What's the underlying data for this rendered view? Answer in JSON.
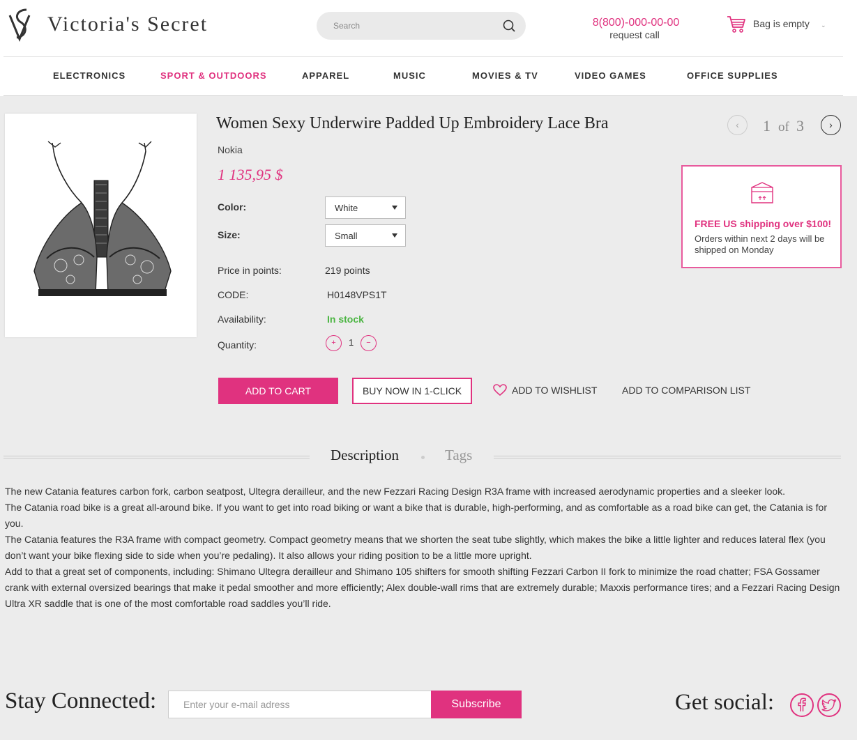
{
  "header": {
    "logo_text": "Victoria's Secret",
    "search_placeholder": "Search",
    "phone": "8(800)-000-00-00",
    "request_call": "request call",
    "bag_text": "Bag is empty"
  },
  "nav": {
    "items": [
      {
        "label": "ELECTRONICS",
        "active": false
      },
      {
        "label": "SPORT & OUTDOORS",
        "active": true
      },
      {
        "label": "APPAREL",
        "active": false
      },
      {
        "label": "MUSIC",
        "active": false
      },
      {
        "label": "MOVIES & TV",
        "active": false
      },
      {
        "label": "VIDEO GAMES",
        "active": false
      },
      {
        "label": "OFFICE SUPPLIES",
        "active": false
      }
    ]
  },
  "product": {
    "title": "Women Sexy Underwire Padded Up Embroidery Lace Bra",
    "brand": "Nokia",
    "price": "1 135,95 $",
    "color_label": "Color:",
    "color_value": "White",
    "size_label": "Size:",
    "size_value": "Small",
    "points_label": "Price in points:",
    "points_value": "219 points",
    "code_label": "CODE:",
    "code_value": "H0148VPS1T",
    "availability_label": "Availability:",
    "availability_value": "In stock",
    "quantity_label": "Quantity:",
    "quantity_value": "1",
    "qty_plus": "+",
    "qty_minus": "−",
    "add_to_cart": "ADD TO CART",
    "buy_now": "BUY NOW IN 1-CLICK",
    "add_to_wishlist": "ADD TO WISHLIST",
    "add_to_comparison": "ADD TO COMPARISON LIST"
  },
  "pager": {
    "current": "1",
    "of": "of",
    "total": "3",
    "prev": "‹",
    "next": "›"
  },
  "shipping": {
    "title": "FREE US shipping over $100!",
    "subtitle": "Orders within next 2 days will be shipped on Monday"
  },
  "tabs": {
    "description": "Description",
    "tags": "Tags"
  },
  "description": [
    "The new Catania features carbon fork, carbon seatpost, Ultegra derailleur, and the new Fezzari Racing Design R3A frame with increased aerodynamic properties and a sleeker look.",
    "The Catania road bike is a great all-around bike. If you want to get into road biking or want a bike that is durable, high-performing, and as comfortable as a road bike can get, the Catania is for you.",
    "The Catania features the R3A frame with compact geometry. Compact geometry means that we shorten the seat tube slightly, which makes the bike a little lighter and reduces lateral flex (you don’t want your bike flexing side to side when you’re pedaling). It also allows your riding position to be a little more upright.",
    "Add to that a great set of components, including: Shimano Ultegra derailleur and Shimano 105 shifters for smooth shifting Fezzari Carbon II fork to minimize the road chatter; FSA Gossamer crank with external oversized bearings that make it pedal smoother and more efficiently; Alex double-wall rims that are extremely durable; Maxxis performance tires; and a Fezzari Racing Design Ultra XR saddle that is one of the most comfortable road saddles you’ll ride."
  ],
  "footer": {
    "stay_connected": "Stay Connected:",
    "email_placeholder": "Enter your e-mail adress",
    "subscribe": "Subscribe",
    "get_social": "Get social:"
  },
  "colors": {
    "accent": "#e0327f",
    "in_stock": "#4bb542"
  }
}
